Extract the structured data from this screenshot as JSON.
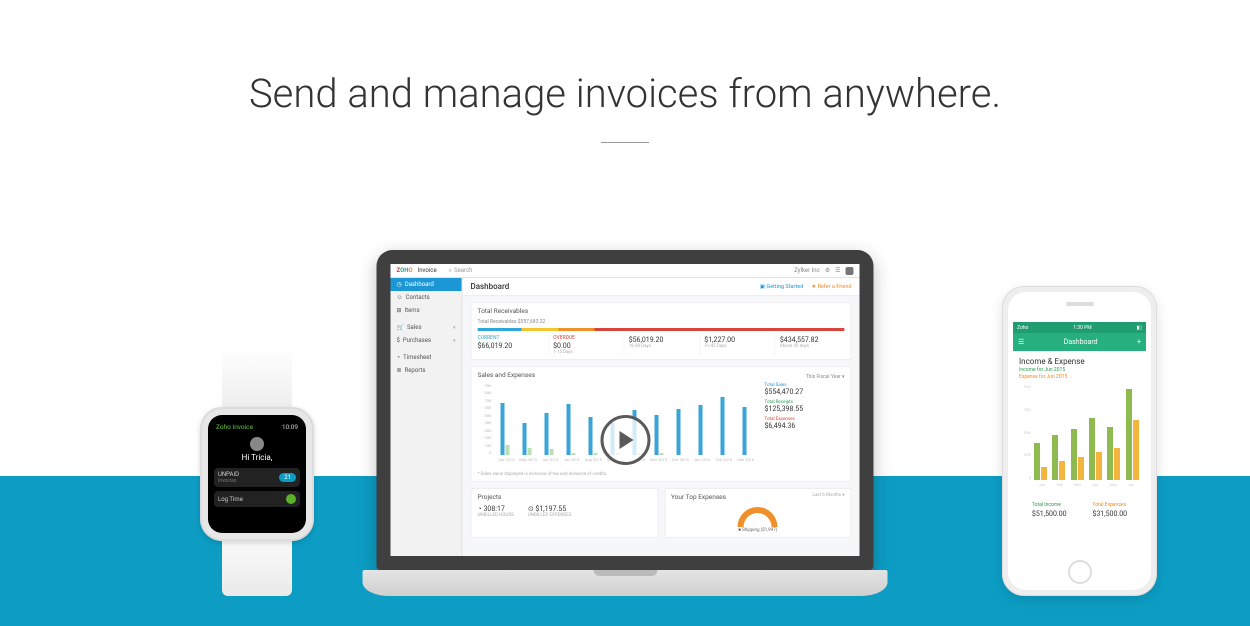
{
  "headline": "Send and manage invoices from anywhere.",
  "watch": {
    "app_name": "Zoho Invoice",
    "time": "10:09",
    "greeting": "Hi Tricia,",
    "card1_label": "UNPAID",
    "card1_sub": "Invoices",
    "card1_count": "21",
    "card2_label": "Log Time"
  },
  "laptop": {
    "product": "Invoice",
    "search_placeholder": "Search",
    "org": "Zylker Inc",
    "sidebar": [
      {
        "label": "Dashboard",
        "active": true
      },
      {
        "label": "Contacts"
      },
      {
        "label": "Items"
      },
      {
        "label": "Sales",
        "caret": true
      },
      {
        "label": "Purchases",
        "caret": true
      },
      {
        "label": "Timesheet"
      },
      {
        "label": "Reports"
      }
    ],
    "page_title": "Dashboard",
    "link_start": "Getting Started",
    "link_refer": "Refer a Friend",
    "recv_title": "Total Receivables",
    "recv_sub": "Total Receivables $557,683.22",
    "recv_cols": [
      {
        "label": "CURRENT",
        "value": "$66,019.20",
        "sub": "",
        "cls": "blue"
      },
      {
        "label": "OVERDUE",
        "value": "$0.00",
        "sub": "1-15 Days",
        "cls": "red"
      },
      {
        "label": "",
        "value": "$56,019.20",
        "sub": "16-30 Days"
      },
      {
        "label": "",
        "value": "$1,227.00",
        "sub": "31-45 Days"
      },
      {
        "label": "",
        "value": "$434,557.82",
        "sub": "Above 45 days"
      }
    ],
    "sales_title": "Sales and Expenses",
    "fiscal": "This Fiscal Year",
    "sales_foot": "* Sales value displayed is inclusive of tax and inclusive of credits.",
    "legend": [
      {
        "label": "Total Sales",
        "value": "$554,470.27",
        "cls": ""
      },
      {
        "label": "Total Receipts",
        "value": "$125,398.55",
        "cls": "green"
      },
      {
        "label": "Total Expenses",
        "value": "$6,494.36",
        "cls": "red"
      }
    ],
    "projects_title": "Projects",
    "projects": [
      {
        "value": "308:17",
        "sub": "UNBILLED HOURS",
        "icon": "clock"
      },
      {
        "value": "$1,197.55",
        "sub": "UNBILLED EXPENSES",
        "icon": "money"
      }
    ],
    "expenses_title": "Your Top Expenses",
    "expenses_period": "Last 6 Months",
    "expense_line": "Shipping ($1,997)"
  },
  "phone": {
    "status_left": "Zoho",
    "status_time": "1:30 PM",
    "nav_title": "Dashboard",
    "nav_plus": "+",
    "content_title": "Income & Expense",
    "sub_income": "Income for Jun 2015",
    "sub_expense": "Expense for Jun 2015",
    "totals": [
      {
        "label": "Total Income",
        "value": "$51,500.00",
        "cls": "l1"
      },
      {
        "label": "Total Expenses",
        "value": "$31,500.00",
        "cls": "l2"
      }
    ]
  },
  "chart_data": [
    {
      "type": "bar",
      "location": "laptop-sales-and-expenses",
      "title": "Sales and Expenses",
      "ylabel": "",
      "ylim": [
        0,
        90000
      ],
      "yticks": [
        "90K",
        "80K",
        "70K",
        "60K",
        "50K",
        "40K",
        "30K",
        "20K",
        "10K",
        "0"
      ],
      "categories": [
        "Apr 2015",
        "May 2015",
        "Jun 2015",
        "Jul 2015",
        "Aug 2015",
        "Sep 2015",
        "Oct 2015",
        "Nov 2015",
        "Dec 2015",
        "Jan 2016",
        "Feb 2016",
        "Mar 2016"
      ],
      "series": [
        {
          "name": "Sales",
          "values": [
            65000,
            40000,
            52000,
            64000,
            48000,
            40000,
            56000,
            50000,
            58000,
            62000,
            72000,
            60000
          ]
        },
        {
          "name": "Expenses",
          "values": [
            12000,
            9000,
            8000,
            3000,
            2000,
            3000,
            3000,
            2000,
            0,
            0,
            0,
            0
          ]
        }
      ]
    },
    {
      "type": "bar",
      "location": "phone-income-expense",
      "title": "Income & Expense",
      "ylim": [
        0,
        90000
      ],
      "yticks": [
        "90K",
        "70K",
        "50K",
        "30K",
        "0"
      ],
      "categories": [
        "Jan",
        "Feb",
        "Mar",
        "Apr",
        "May",
        "Jun"
      ],
      "series": [
        {
          "name": "Income",
          "values": [
            35000,
            42000,
            48000,
            58000,
            50000,
            85000
          ]
        },
        {
          "name": "Expense",
          "values": [
            12000,
            18000,
            22000,
            26000,
            30000,
            56000
          ]
        }
      ]
    }
  ]
}
